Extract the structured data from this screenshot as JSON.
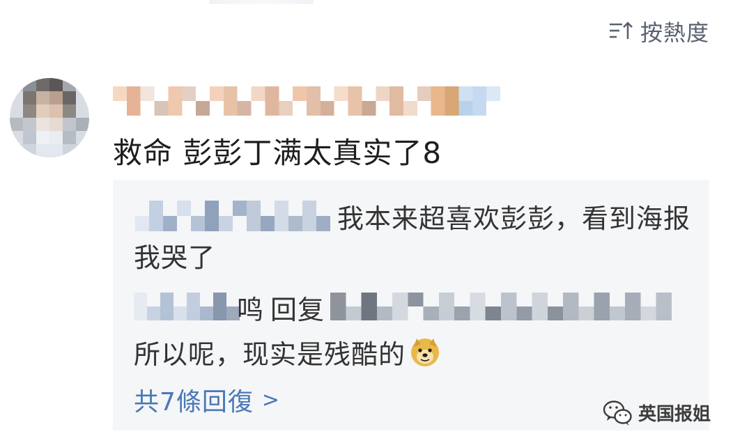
{
  "sort": {
    "icon": "sort-icon",
    "label": "按熱度"
  },
  "comment": {
    "avatar_icon": "avatar",
    "text": "救命 彭彭丁满太真实了8"
  },
  "replies": [
    {
      "text": "我本来超喜欢彭彭，看到海报我哭了"
    },
    {
      "name_tail": "鸣",
      "action": "回复",
      "text": "所以呢，现实是残酷的",
      "emoji_icon": "doge-emoji-icon"
    }
  ],
  "more_replies": {
    "label": "共7條回復",
    "chevron": ">"
  },
  "watermark": {
    "icon": "wechat-icon",
    "text": "英国报姐"
  }
}
